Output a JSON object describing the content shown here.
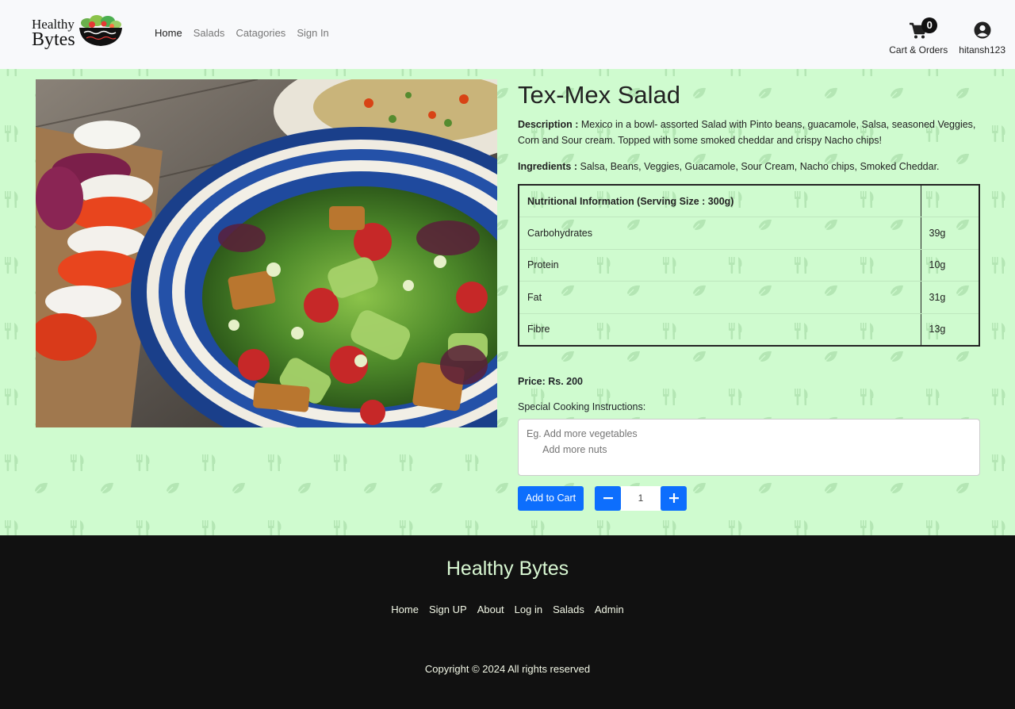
{
  "brand": {
    "line1": "Healthy",
    "line2": "Bytes"
  },
  "nav": {
    "links": [
      {
        "label": "Home"
      },
      {
        "label": "Salads"
      },
      {
        "label": "Catagories"
      },
      {
        "label": "Sign In"
      }
    ],
    "cart": {
      "label": "Cart & Orders",
      "count": "0"
    },
    "user": {
      "label": "hitansh123"
    }
  },
  "product": {
    "name": "Tex-Mex Salad",
    "description_label": "Description :",
    "description": " Mexico in a bowl- assorted Salad with Pinto beans, guacamole, Salsa, seasoned Veggies, Corn and Sour cream. Topped with some smoked cheddar and crispy Nacho chips!",
    "ingredients_label": "Ingredients :",
    "ingredients": " Salsa, Beans, Veggies, Guacamole, Sour Cream, Nacho chips, Smoked Cheddar.",
    "nutrition": {
      "header": "Nutritional Information (Serving Size : 300g)",
      "rows": [
        {
          "name": "Carbohydrates",
          "value": "39g"
        },
        {
          "name": "Protein",
          "value": "10g"
        },
        {
          "name": "Fat",
          "value": "31g"
        },
        {
          "name": "Fibre",
          "value": "13g"
        }
      ]
    },
    "price": "Price: Rs. 200",
    "instructions_label": "Special Cooking Instructions:",
    "instructions_placeholder": "Eg. Add more vegetables\n      Add more nuts",
    "add_to_cart": "Add to Cart",
    "quantity": "1"
  },
  "footer": {
    "title": "Healthy Bytes",
    "links": [
      {
        "label": "Home"
      },
      {
        "label": "Sign UP"
      },
      {
        "label": "About"
      },
      {
        "label": "Log in"
      },
      {
        "label": "Salads"
      },
      {
        "label": "Admin"
      }
    ],
    "copyright": "Copyright © 2024 All rights reserved"
  },
  "colors": {
    "main_bg": "#cffbcf",
    "primary": "#0d6efd",
    "footer_bg": "#111111",
    "footer_title": "#d8f7d2"
  },
  "icons": [
    "salad-bowl-logo-icon",
    "cart-icon",
    "user-circle-icon",
    "minus-icon",
    "plus-icon",
    "fork-knife-icon",
    "leaf-icon"
  ]
}
